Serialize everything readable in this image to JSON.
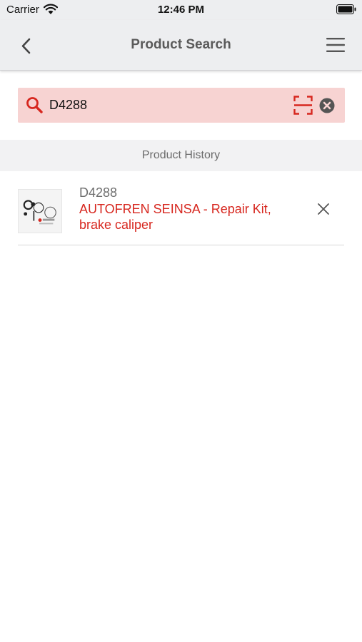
{
  "status_bar": {
    "carrier": "Carrier",
    "time": "12:46 PM",
    "icons": [
      "wifi-icon",
      "battery-icon"
    ]
  },
  "nav": {
    "title": "Product Search",
    "back_icon": "chevron-left-icon",
    "menu_icon": "hamburger-menu-icon"
  },
  "search": {
    "value": "D4288",
    "placeholder": "",
    "icons": [
      "search-icon",
      "barcode-scan-icon",
      "clear-icon"
    ]
  },
  "history": {
    "header": "Product History",
    "items": [
      {
        "code": "D4288",
        "description": "AUTOFREN SEINSA - Repair Kit, brake caliper",
        "thumbnail": "product-thumbnail",
        "remove_icon": "close-icon"
      }
    ]
  },
  "colors": {
    "accent": "#d7271f",
    "search_background": "#f7d3d2",
    "nav_background": "#edeef0",
    "section_header_background": "#f2f2f3"
  }
}
